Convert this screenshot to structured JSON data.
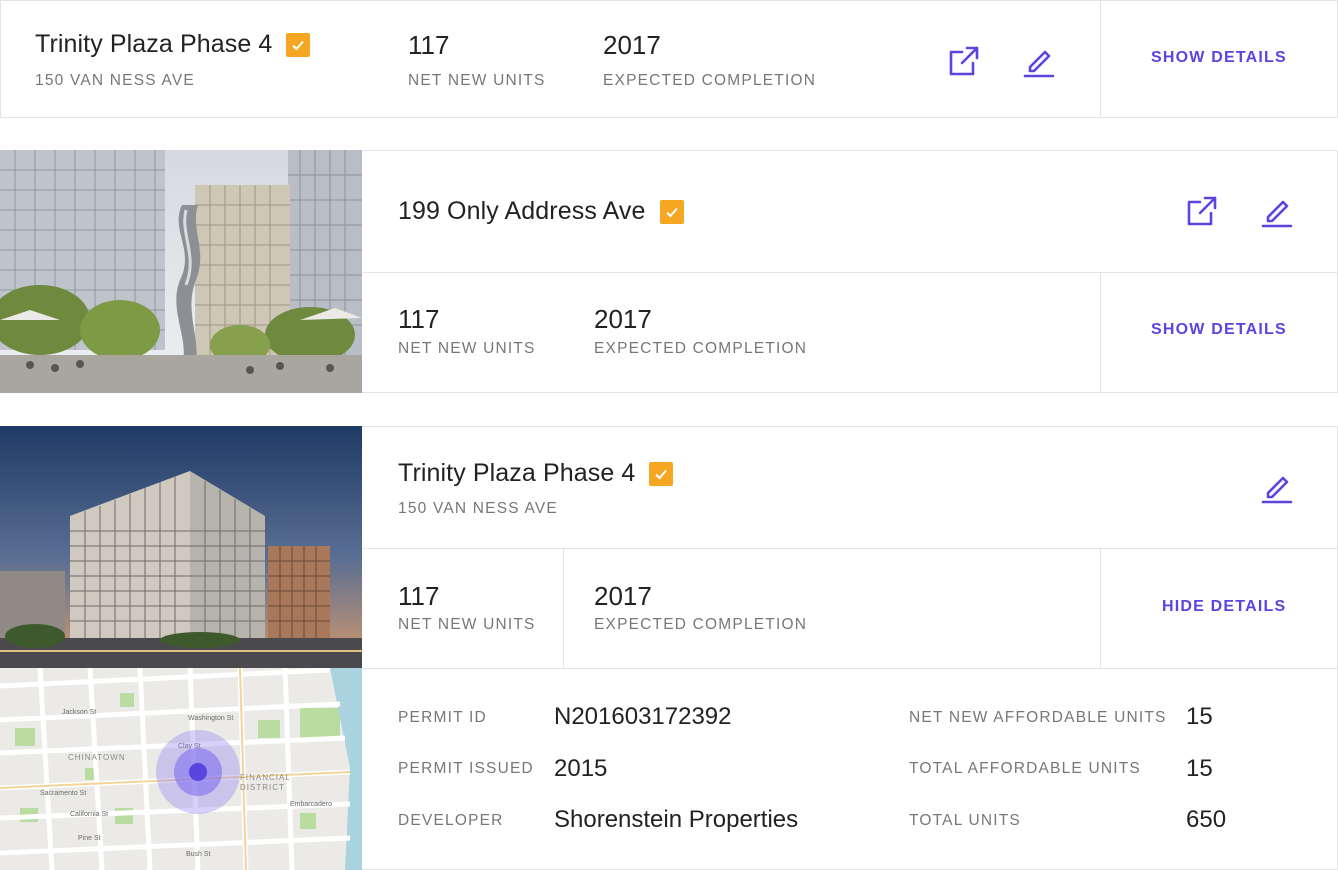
{
  "colors": {
    "accent": "#5b45e0",
    "check": "#f5a623",
    "border": "#e4e4e4",
    "label": "#777777"
  },
  "card1": {
    "title": "Trinity Plaza Phase 4",
    "address": "150 VAN NESS AVE",
    "units_value": "117",
    "units_label": "NET NEW UNITS",
    "completion_value": "2017",
    "completion_label": "EXPECTED COMPLETION",
    "action_label": "SHOW DETAILS"
  },
  "card2": {
    "title": "199 Only Address Ave",
    "units_value": "117",
    "units_label": "NET NEW UNITS",
    "completion_value": "2017",
    "completion_label": "EXPECTED COMPLETION",
    "action_label": "SHOW DETAILS"
  },
  "card3": {
    "title": "Trinity Plaza Phase 4",
    "address": "150 VAN NESS AVE",
    "units_value": "117",
    "units_label": "NET NEW UNITS",
    "completion_value": "2017",
    "completion_label": "EXPECTED COMPLETION",
    "action_label": "HIDE DETAILS",
    "details": {
      "permit_id_label": "PERMIT ID",
      "permit_id_value": "N201603172392",
      "permit_issued_label": "PERMIT ISSUED",
      "permit_issued_value": "2015",
      "developer_label": "DEVELOPER",
      "developer_value": "Shorenstein Properties",
      "affordable_label": "NET NEW AFFORDABLE UNITS",
      "affordable_value": "15",
      "total_affordable_label": "TOTAL AFFORDABLE UNITS",
      "total_affordable_value": "15",
      "total_units_label": "TOTAL UNITS",
      "total_units_value": "650"
    },
    "map_labels": {
      "chinatown": "CHINATOWN",
      "financial": "FINANCIAL",
      "district": "DISTRICT",
      "jackson": "Jackson St",
      "washington": "Washington St",
      "clay": "Clay St",
      "sacramento": "Sacramento St",
      "california": "California St",
      "pine": "Pine St",
      "bush": "Bush St",
      "embarcadero": "Embarcadero"
    }
  },
  "icons": {
    "external": "external-link-icon",
    "edit": "edit-pencil-icon",
    "check": "checkbox-checked-icon"
  }
}
